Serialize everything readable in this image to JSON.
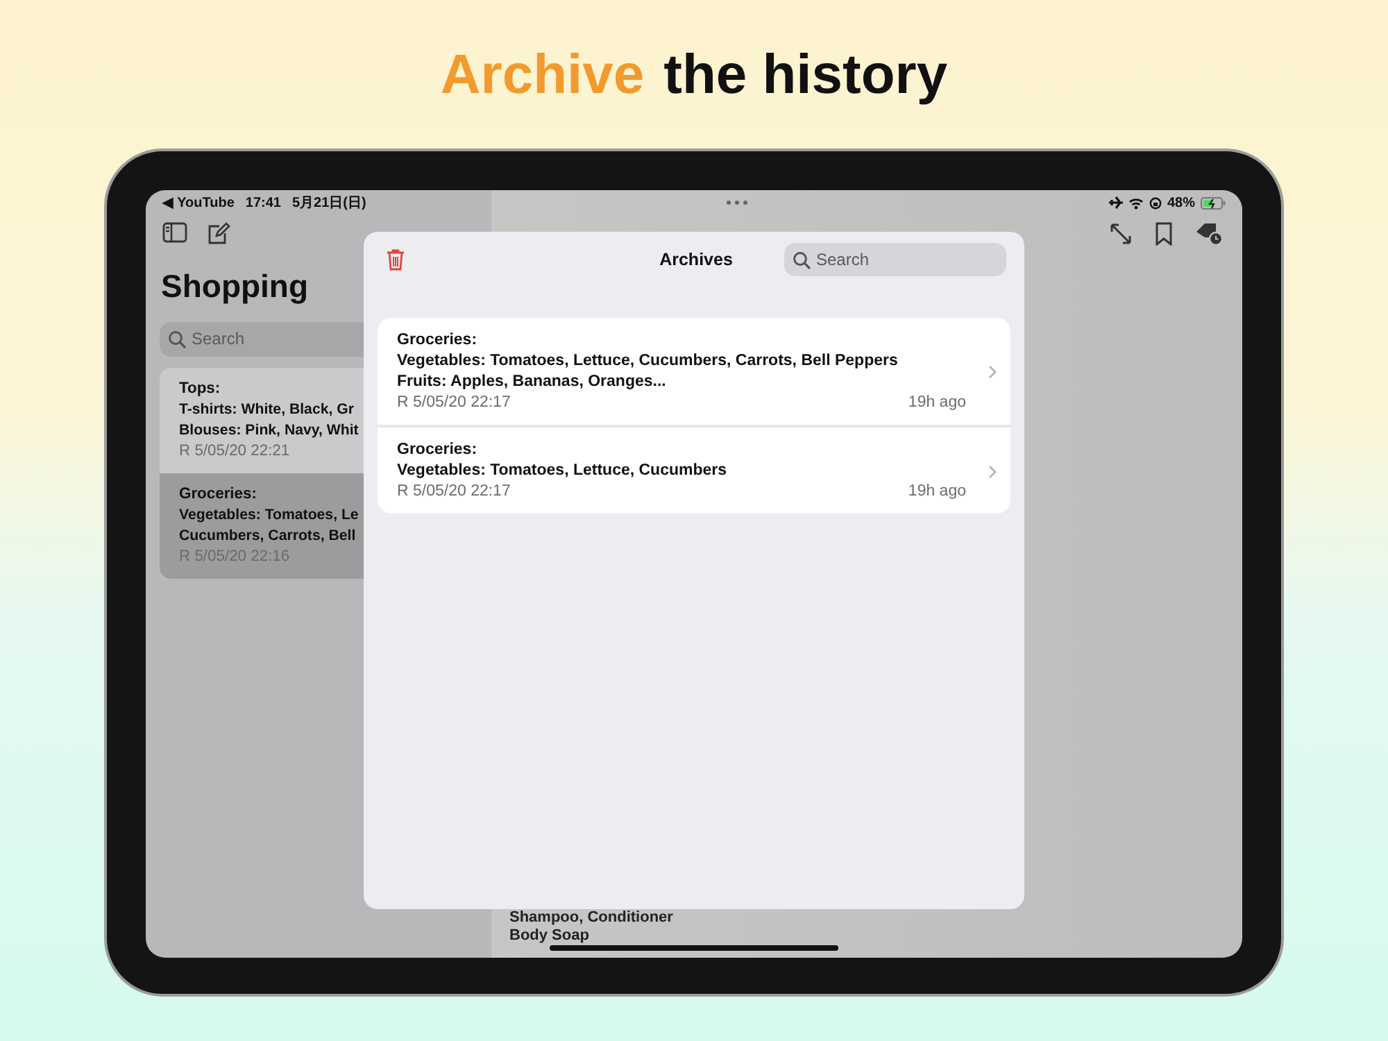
{
  "headline": {
    "accent": "Archive",
    "rest": "the history"
  },
  "status_bar": {
    "back": "◀ YouTube",
    "time": "17:41",
    "date": "5月21日(日)",
    "battery": "48%"
  },
  "sidebar": {
    "title": "Shopping",
    "search": {
      "placeholder": "Search"
    },
    "notes": [
      {
        "lines": [
          "Tops:",
          "T-shirts: White, Black, Gr",
          "Blouses: Pink, Navy, Whit"
        ],
        "date": "R 5/05/20 22:21",
        "selected": false
      },
      {
        "lines": [
          "Groceries:",
          "Vegetables: Tomatoes, Le",
          "Cucumbers, Carrots, Bell"
        ],
        "date": "R 5/05/20 22:16",
        "selected": true
      }
    ]
  },
  "detail": {
    "lines": [
      "Shampoo, Conditioner",
      "Body Soap"
    ]
  },
  "archives_modal": {
    "title": "Archives",
    "search": {
      "placeholder": "Search"
    },
    "items": [
      {
        "lines": [
          "Groceries:",
          "Vegetables: Tomatoes, Lettuce, Cucumbers, Carrots, Bell Peppers",
          "Fruits: Apples, Bananas, Oranges..."
        ],
        "date": "R 5/05/20 22:17",
        "age": "19h ago"
      },
      {
        "lines": [
          "Groceries:",
          "Vegetables: Tomatoes, Lettuce, Cucumbers"
        ],
        "date": "R 5/05/20 22:17",
        "age": "19h ago"
      }
    ]
  }
}
